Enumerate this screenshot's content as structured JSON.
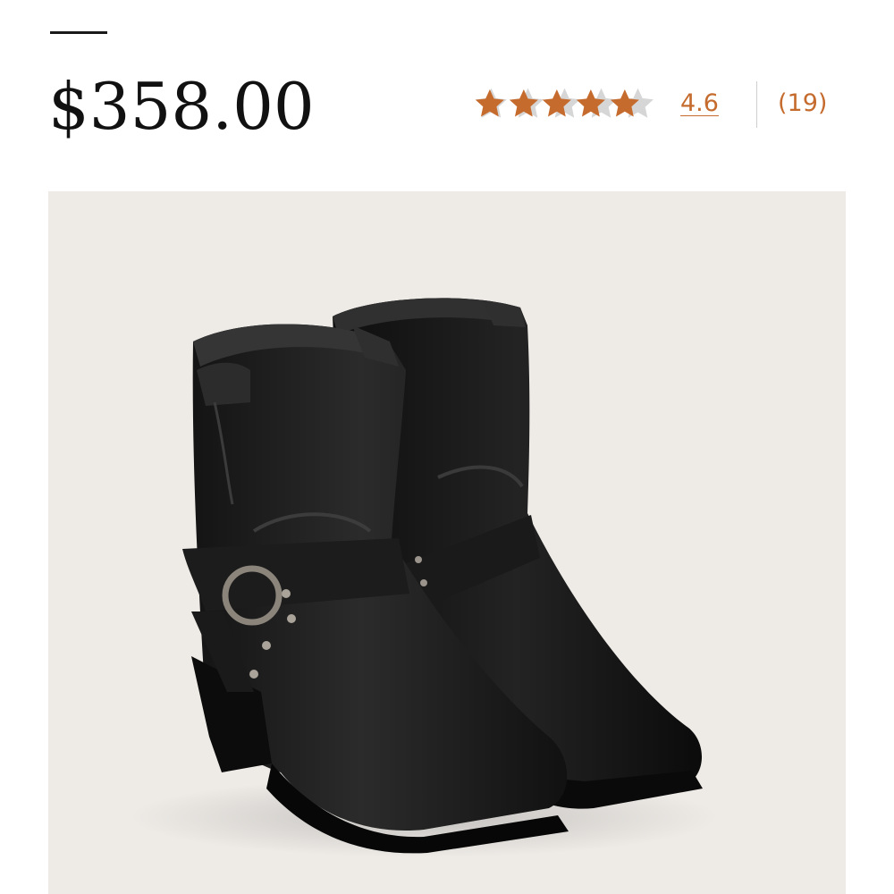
{
  "product": {
    "price": "$358.00",
    "image_alt": "black leather harness ankle boots"
  },
  "rating": {
    "value": "4.6",
    "fraction": 0.92,
    "review_count": "(19)",
    "star_icon": "star-icon"
  },
  "colors": {
    "accent": "#c56b2e",
    "star_filled": "#c56b2e",
    "star_empty": "#d6d6d6",
    "image_background": "#eeebe7",
    "text": "#111111"
  }
}
